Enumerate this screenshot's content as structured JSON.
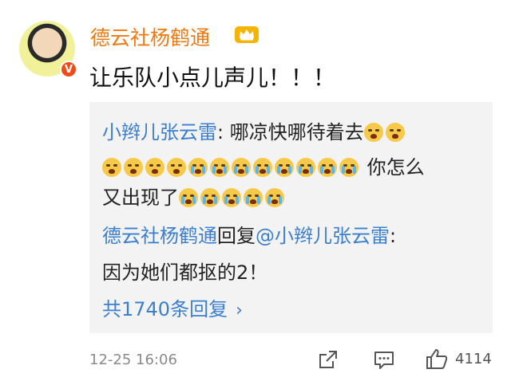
{
  "post": {
    "username": "德云社杨鹤通",
    "text": "让乐队小点儿声儿！！！",
    "timestamp": "12-25 16:06",
    "likes": "4114"
  },
  "replies": {
    "first": {
      "author": "小辫儿张云雷",
      "sep": ": ",
      "text_a": "哪凉快哪待着去",
      "text_b": " 你怎么",
      "text_c": "又出现了"
    },
    "second": {
      "author": "德云社杨鹤通",
      "verb": "回复",
      "mention": "@小辫儿张云雷",
      "sep": ":",
      "text": "因为她们都抠的2！"
    },
    "more_label": "共1740条回复",
    "more_chevron": "›"
  },
  "icons": {
    "avatar_badge": "V",
    "crown": "crown-icon",
    "share": "share-icon",
    "comment": "comment-icon",
    "like": "thumbs-up-icon"
  },
  "colors": {
    "username": "#ee7a12",
    "link": "#3b7fd0",
    "reply_bg": "#f3f3f3"
  }
}
